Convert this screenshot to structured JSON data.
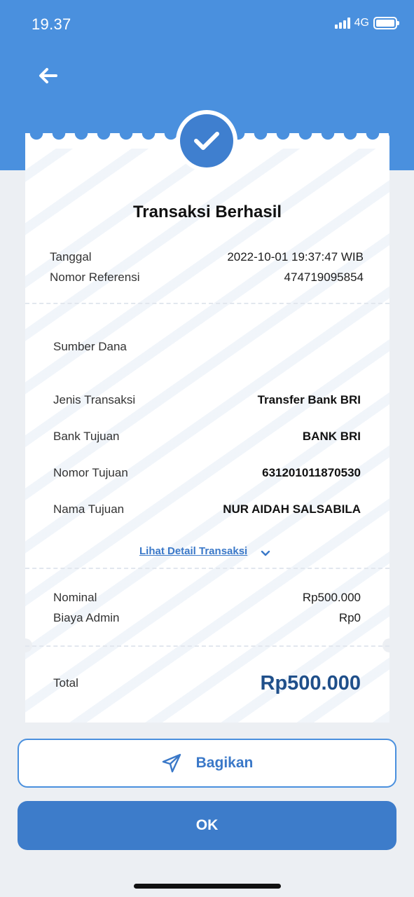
{
  "status_bar": {
    "time": "19.37",
    "network": "4G",
    "icons": [
      "signal-icon",
      "battery-icon"
    ]
  },
  "header": {
    "back_icon": "arrow-left-icon",
    "status_icon": "checkmark-icon"
  },
  "receipt": {
    "title": "Transaksi Berhasil",
    "date_label": "Tanggal",
    "date_value": "2022-10-01 19:37:47 WIB",
    "reference_label": "Nomor Referensi",
    "reference_value": "474719095854",
    "source_label": "Sumber Dana",
    "transaction_type_label": "Jenis Transaksi",
    "transaction_type_value": "Transfer Bank BRI",
    "destination_bank_label": "Bank Tujuan",
    "destination_bank_value": "BANK BRI",
    "destination_number_label": "Nomor Tujuan",
    "destination_number_value": "631201011870530",
    "destination_name_label": "Nama Tujuan",
    "destination_name_value": "NUR AIDAH SALSABILA",
    "detail_link": "Lihat Detail Transaksi",
    "nominal_label": "Nominal",
    "nominal_value": "Rp500.000",
    "admin_fee_label": "Biaya Admin",
    "admin_fee_value": "Rp0",
    "total_label": "Total",
    "total_value": "Rp500.000"
  },
  "actions": {
    "share_label": "Bagikan",
    "share_icon": "send-icon",
    "ok_label": "OK"
  },
  "colors": {
    "header_blue": "#4a90de",
    "button_blue": "#3d7cca",
    "total_text": "#1f4f8a",
    "link": "#3a78c8",
    "background": "#eceff3"
  }
}
